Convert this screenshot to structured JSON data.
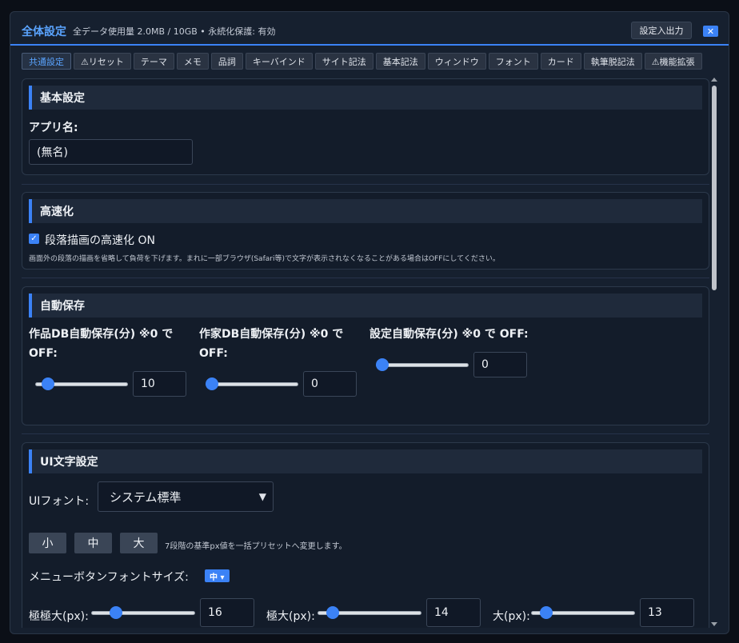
{
  "header": {
    "title": "全体設定",
    "usage": "全データ使用量 2.0MB / 10GB • 永続化保護: 有効",
    "io_label": "設定入出力",
    "close_glyph": "✕"
  },
  "tabs": [
    {
      "label": "共通設定",
      "active": true
    },
    {
      "label": "⚠リセット"
    },
    {
      "label": "テーマ"
    },
    {
      "label": "メモ"
    },
    {
      "label": "品詞"
    },
    {
      "label": "キーバインド"
    },
    {
      "label": "サイト記法"
    },
    {
      "label": "基本記法"
    },
    {
      "label": "ウィンドウ"
    },
    {
      "label": "フォント"
    },
    {
      "label": "カード"
    },
    {
      "label": "執筆脱記法"
    },
    {
      "label": "⚠機能拡張"
    }
  ],
  "basic": {
    "heading": "基本設定",
    "app_name_label": "アプリ名:",
    "app_name_value": "(無名)"
  },
  "speed": {
    "heading": "高速化",
    "checkbox_label": "段落描画の高速化 ON",
    "checked": true,
    "description": "画面外の段落の描画を省略して負荷を下げます。まれに一部ブラウザ(Safari等)で文字が表示されなくなることがある場合はOFFにしてください。"
  },
  "autosave": {
    "heading": "自動保存",
    "items": [
      {
        "label_line1": "作品DB自動保存(分) ※0 で",
        "label_line2": "OFF:",
        "value": "10",
        "level": 0.08
      },
      {
        "label_line1": "作家DB自動保存(分) ※0 で",
        "label_line2": "OFF:",
        "value": "0",
        "level": 0
      },
      {
        "label_line1": "設定自動保存(分) ※0 で OFF:",
        "label_line2": "",
        "value": "0",
        "level": 0
      }
    ]
  },
  "ui_text": {
    "heading": "UI文字設定",
    "font_label": "UIフォント:",
    "font_value": "システム標準",
    "presets": [
      "小",
      "中",
      "大"
    ],
    "preset_note": "7段階の基準px値を一括プリセットへ変更します。",
    "menu_font_label": "メニューボタンフォントサイズ:",
    "menu_font_value": "中 ▾",
    "sizes": [
      {
        "label": "極極大(px):",
        "value": "16",
        "level": 0.2
      },
      {
        "label": "極大(px):",
        "value": "14",
        "level": 0.1
      },
      {
        "label": "大(px):",
        "value": "13",
        "level": 0.1
      }
    ]
  }
}
